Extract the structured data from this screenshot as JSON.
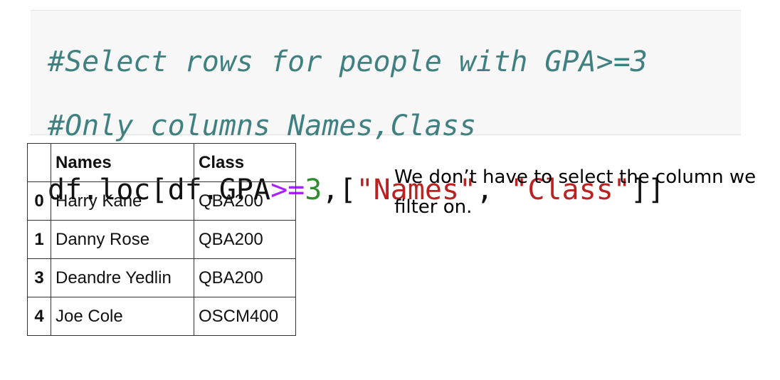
{
  "code_cell": {
    "line1": "#Select rows for people with GPA>=3",
    "line2": "#Only columns Names,Class",
    "line3": {
      "p1": "df.loc[df.GPA",
      "op": ">=",
      "num": "3",
      "p2": ",[",
      "s1": "\"Names\"",
      "p3": ", ",
      "s2": "\"Class\"",
      "p4": "]]"
    }
  },
  "table": {
    "headers": [
      "",
      "Names",
      "Class"
    ],
    "rows": [
      {
        "index": "0",
        "names": "Harry Kane",
        "class": "QBA200"
      },
      {
        "index": "1",
        "names": "Danny Rose",
        "class": "QBA200"
      },
      {
        "index": "3",
        "names": "Deandre Yedlin",
        "class": "QBA200"
      },
      {
        "index": "4",
        "names": "Joe Cole",
        "class": "OSCM400"
      }
    ]
  },
  "note": {
    "text": "We don’t have to select the column we filter on."
  }
}
